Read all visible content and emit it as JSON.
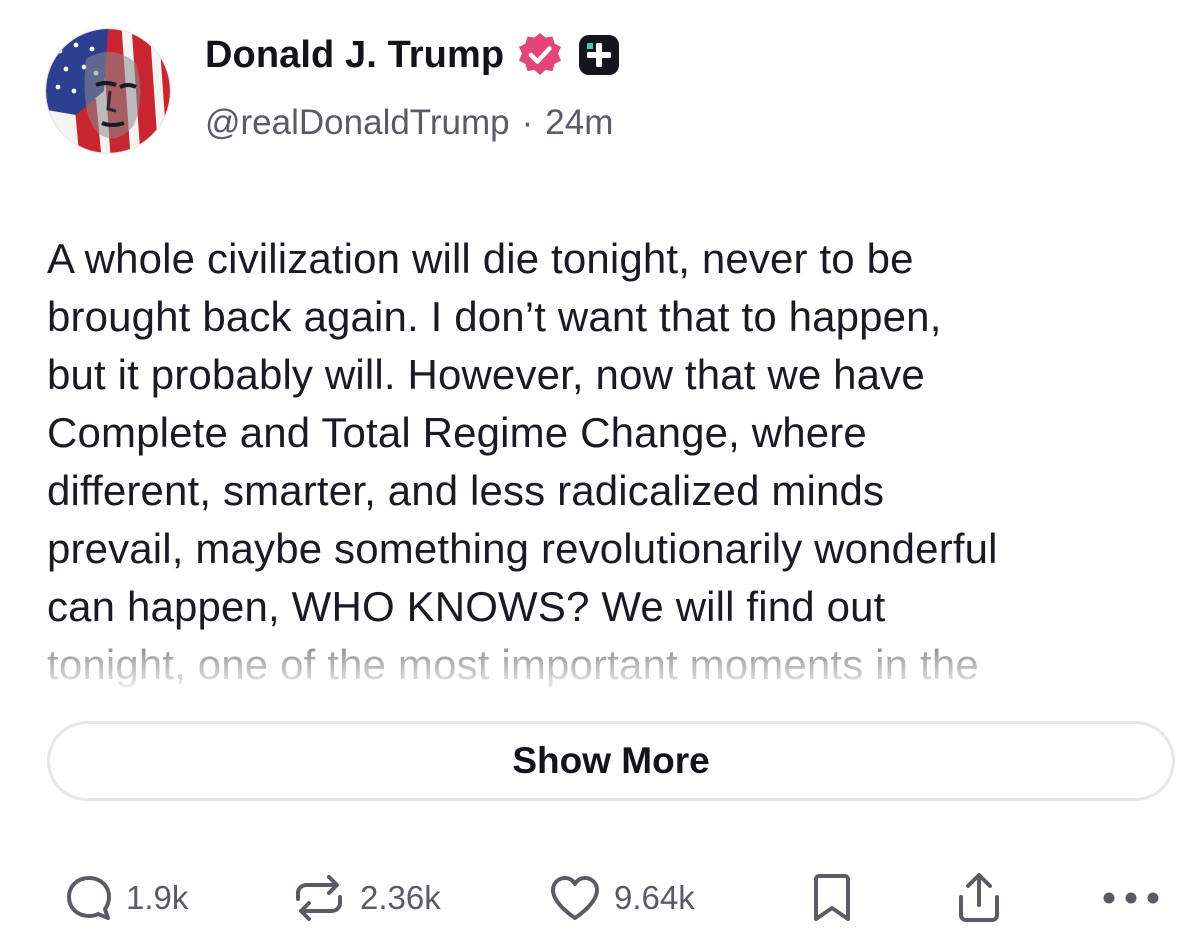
{
  "post": {
    "author": {
      "display_name": "Donald J. Trump",
      "handle": "@realDonaldTrump",
      "timestamp": "24m",
      "separator": "·",
      "avatar_icon": "flag-portrait-avatar",
      "verified_icon": "verified-badge-icon",
      "verified_color": "#e2457a",
      "plus_icon": "plus-badge-icon"
    },
    "text_lines": [
      "A whole civilization will die tonight, never to be",
      "brought back again. I don’t want that to happen,",
      "but it probably will. However, now that we have",
      "Complete and Total Regime Change, where",
      "different, smarter, and less radicalized minds",
      "prevail, maybe something revolutionarily wonderful",
      "can happen, WHO KNOWS? We will find out",
      "tonight, one of the most important moments in the"
    ],
    "show_more_label": "Show More"
  },
  "actions": {
    "reply": {
      "icon": "reply-icon",
      "count": "1.9k"
    },
    "repost": {
      "icon": "repost-icon",
      "count": "2.36k"
    },
    "like": {
      "icon": "heart-icon",
      "count": "9.64k"
    },
    "bookmark": {
      "icon": "bookmark-icon"
    },
    "share": {
      "icon": "share-icon"
    },
    "more": {
      "icon": "more-icon"
    }
  },
  "colors": {
    "text": "#1a1924",
    "muted": "#5c5a66",
    "border": "#e6e6ec",
    "accent": "#e2457a"
  }
}
